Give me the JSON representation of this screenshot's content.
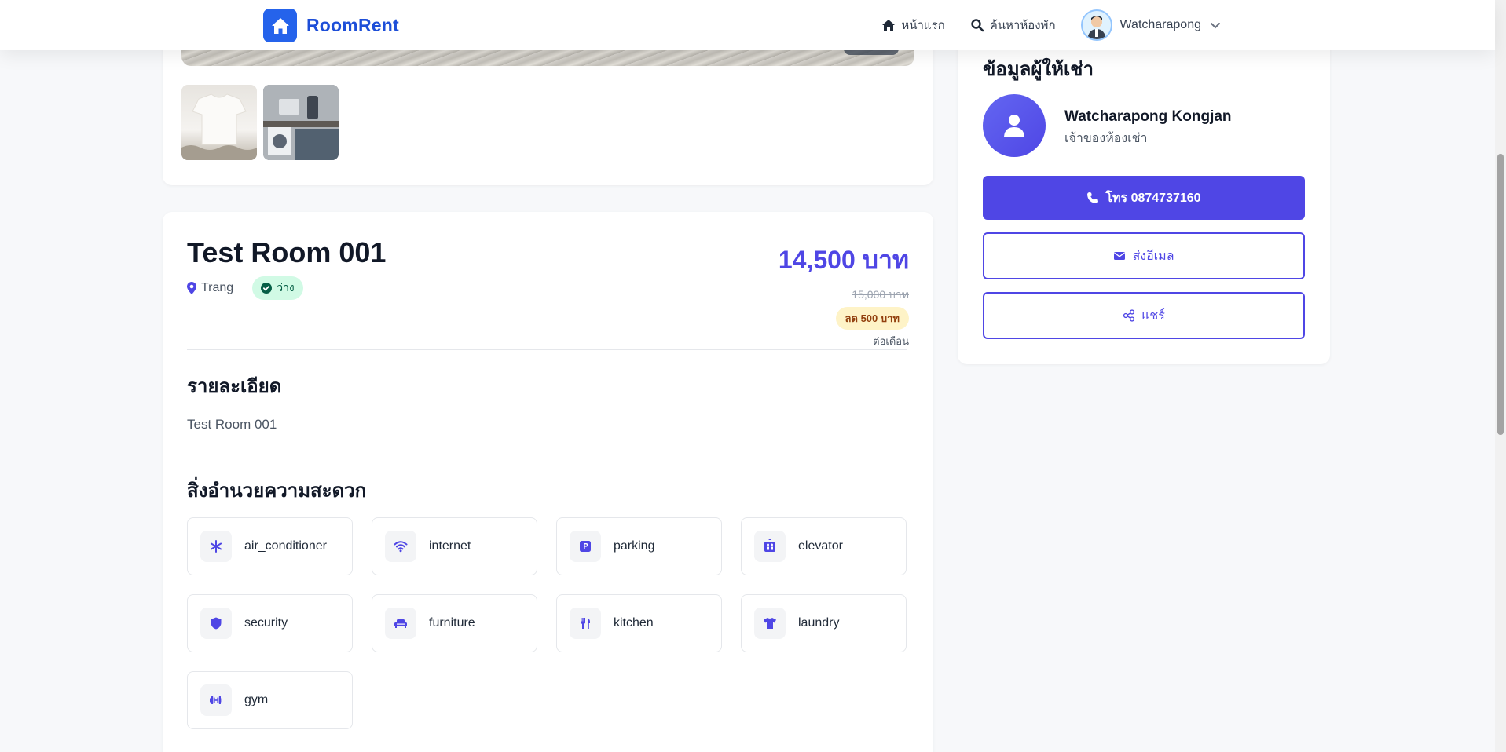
{
  "navbar": {
    "brand": "RoomRent",
    "links": {
      "home": "หน้าแรก",
      "search": "ค้นหาห้องพัก"
    },
    "user_name": "Watcharapong"
  },
  "room": {
    "title": "Test Room 001",
    "location": "Trang",
    "status": "ว่าง",
    "price": "14,500 บาท",
    "old_price": "15,000 บาท",
    "discount": "ลด 500 บาท",
    "per_month": "ต่อเดือน"
  },
  "sections": {
    "details_title": "รายละเอียด",
    "description": "Test Room 001",
    "amenities_title": "สิ่งอำนวยความสะดวก"
  },
  "amenities": [
    {
      "label": "air_conditioner",
      "icon": "snowflake-icon"
    },
    {
      "label": "internet",
      "icon": "wifi-icon"
    },
    {
      "label": "parking",
      "icon": "parking-icon"
    },
    {
      "label": "elevator",
      "icon": "elevator-icon"
    },
    {
      "label": "security",
      "icon": "shield-icon"
    },
    {
      "label": "furniture",
      "icon": "couch-icon"
    },
    {
      "label": "kitchen",
      "icon": "utensils-icon"
    },
    {
      "label": "laundry",
      "icon": "shirt-icon"
    },
    {
      "label": "gym",
      "icon": "dumbbell-icon"
    }
  ],
  "landlord": {
    "title": "ข้อมูลผู้ให้เช่า",
    "name": "Watcharapong Kongjan",
    "role": "เจ้าของห้องเช่า",
    "call_label": "โทร 0874737160",
    "email_label": "ส่งอีเมล",
    "share_label": "แชร์"
  },
  "colors": {
    "brand": "#2563eb",
    "accent": "#4f46e5",
    "status_bg": "#d1fae5",
    "discount_bg": "#fef3c7"
  }
}
